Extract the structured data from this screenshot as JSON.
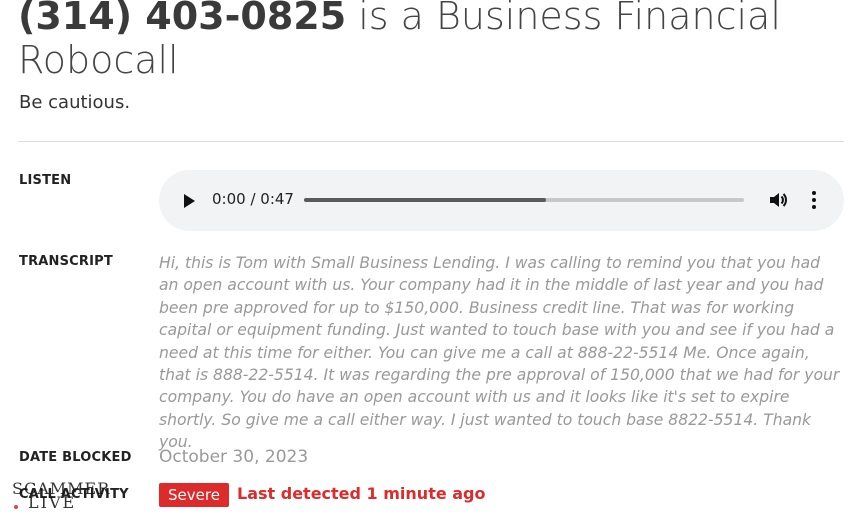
{
  "header": {
    "phone_number": "(314) 403-0825",
    "title_suffix": " is a Business Financial Robocall",
    "subtitle": "Be cautious."
  },
  "listen": {
    "label": "LISTEN",
    "time_display": "0:00 / 0:47",
    "buffered_fraction": 0.55
  },
  "transcript": {
    "label": "TRANSCRIPT",
    "text": "Hi, this is Tom with Small Business Lending. I was calling to remind you that you had an open account with us. Your company had it in the middle of last year and you had been pre approved for up to $150,000. Business credit line. That was for working capital or equipment funding. Just wanted to touch base with you and see if you had a need at this time for either. You can give me a call at 888-22-5514 Me. Once again, that is 888-22-5514. It was regarding the pre approval of 150,000 that we had for your company. You do have an open account with us and it looks like it's set to expire shortly. So give me a call either way. I just wanted to touch base 8822-5514. Thank you."
  },
  "date_blocked": {
    "label": "DATE BLOCKED",
    "value": "October 30, 2023"
  },
  "call_activity": {
    "label": "CALL ACTIVITY",
    "severity": "Severe",
    "last_detected": "Last detected 1 minute ago"
  },
  "watermark": {
    "line1": "SCAMMER",
    "line2": "LIVE"
  },
  "colors": {
    "severe": "#dd2a2a",
    "muted_text": "#999999",
    "player_bg": "#f1f3f4"
  }
}
